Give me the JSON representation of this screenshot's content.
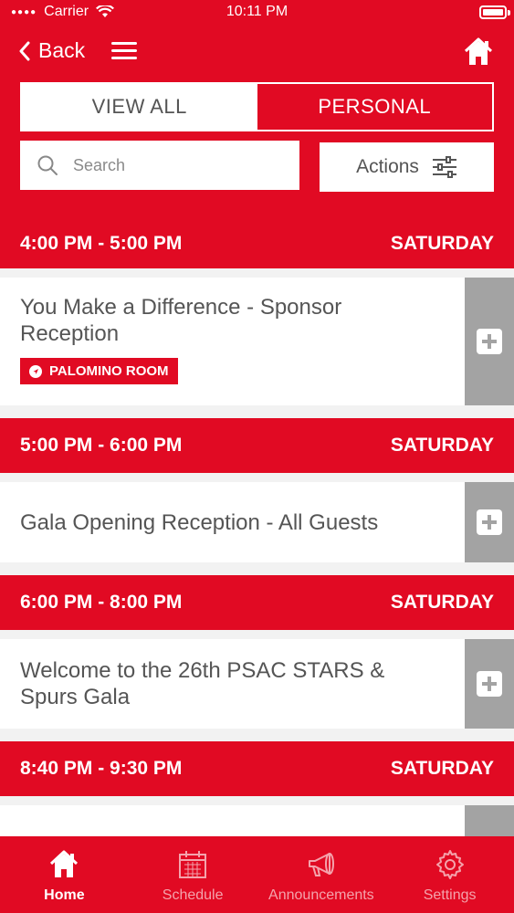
{
  "status_bar": {
    "carrier": "Carrier",
    "time": "10:11 PM"
  },
  "header": {
    "back_label": "Back",
    "segments": [
      "VIEW ALL",
      "PERSONAL"
    ],
    "active_segment": "VIEW ALL",
    "search_placeholder": "Search",
    "actions_label": "Actions"
  },
  "schedule": [
    {
      "time": "4:00 PM - 5:00 PM",
      "day": "SATURDAY",
      "title": "You Make a Difference - Sponsor Reception",
      "location": "PALOMINO ROOM"
    },
    {
      "time": "5:00 PM - 6:00 PM",
      "day": "SATURDAY",
      "title": "Gala Opening Reception - All Guests"
    },
    {
      "time": "6:00 PM - 8:00 PM",
      "day": "SATURDAY",
      "title": "Welcome to the 26th PSAC STARS & Spurs Gala"
    },
    {
      "time": "8:40 PM - 9:30 PM",
      "day": "SATURDAY",
      "title": ""
    }
  ],
  "tabbar": {
    "items": [
      {
        "label": "Home",
        "icon": "home-icon",
        "active": true
      },
      {
        "label": "Schedule",
        "icon": "calendar-icon",
        "active": false
      },
      {
        "label": "Announcements",
        "icon": "megaphone-icon",
        "active": false
      },
      {
        "label": "Settings",
        "icon": "gear-icon",
        "active": false
      }
    ]
  },
  "colors": {
    "brand": "#e10a23",
    "add_button": "#a3a3a3",
    "text": "#555555"
  }
}
